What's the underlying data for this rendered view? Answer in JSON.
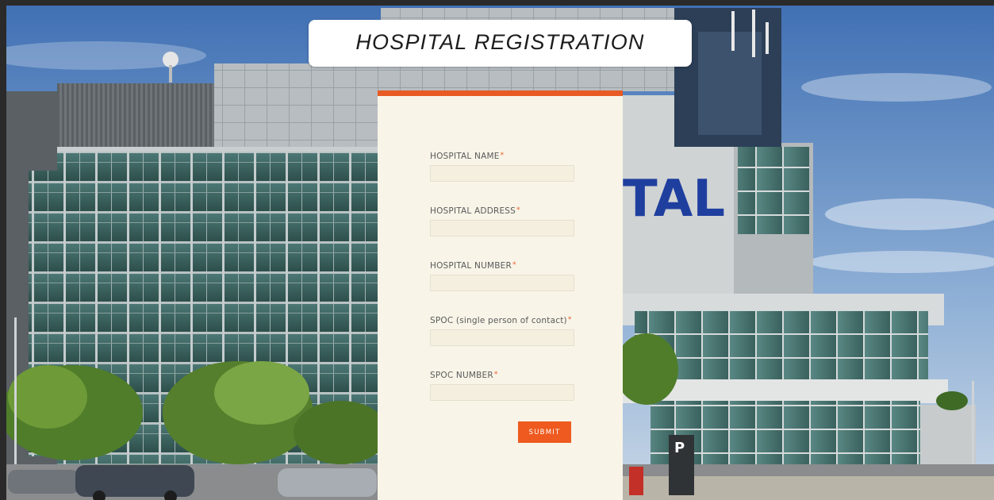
{
  "header": {
    "title": "HOSPITAL REGISTRATION"
  },
  "background": {
    "sign_text": "TAL",
    "parking_sign": "P"
  },
  "form": {
    "fields": [
      {
        "label": "HOSPITAL NAME",
        "required_mark": "*",
        "value": ""
      },
      {
        "label": "HOSPITAL ADDRESS",
        "required_mark": "*",
        "value": ""
      },
      {
        "label": "HOSPITAL NUMBER",
        "required_mark": "*",
        "value": ""
      },
      {
        "label": "SPOC (single person of contact)",
        "required_mark": "*",
        "value": ""
      },
      {
        "label": "SPOC NUMBER",
        "required_mark": "*",
        "value": ""
      }
    ],
    "submit_label": "SUBMIT"
  },
  "colors": {
    "accent": "#e85a24",
    "card_background": "#f8f4e8",
    "title_background": "#ffffff"
  }
}
